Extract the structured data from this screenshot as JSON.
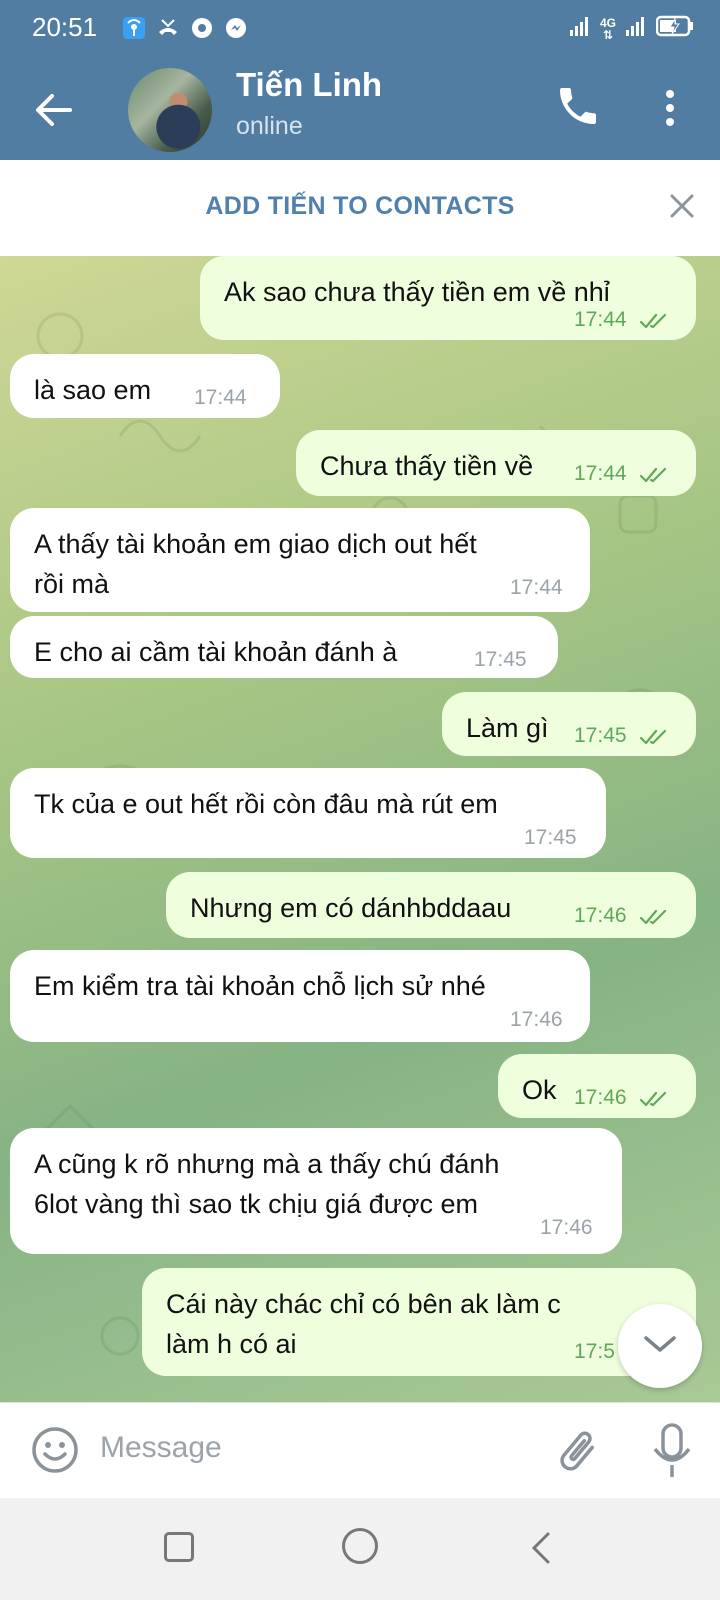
{
  "status_bar": {
    "time": "20:51",
    "network_label": "4G",
    "icons": [
      "hotspot-icon",
      "missed-call-icon",
      "chrome-icon",
      "messenger-icon",
      "signal-icon",
      "signal-icon",
      "battery-charging-icon"
    ]
  },
  "header": {
    "contact_name": "Tiến Linh",
    "presence": "online",
    "icons": [
      "back-arrow-icon",
      "phone-icon",
      "more-vertical-icon"
    ]
  },
  "contact_bar": {
    "add_label": "ADD TIẾN TO CONTACTS",
    "close_icon": "close-icon"
  },
  "messages": [
    {
      "side": "out",
      "text": "Ak sao chưa thấy tiền em về nhỉ",
      "time": "17:44",
      "read": true
    },
    {
      "side": "in",
      "text": "là sao em",
      "time": "17:44"
    },
    {
      "side": "out",
      "text": "Chưa thấy tiền về",
      "time": "17:44",
      "read": true
    },
    {
      "side": "in",
      "text": "A thấy tài khoản em giao dịch out hết\nrồi mà",
      "time": "17:44"
    },
    {
      "side": "in",
      "text": "E cho ai cầm tài khoản đánh à",
      "time": "17:45"
    },
    {
      "side": "out",
      "text": "Làm gì",
      "time": "17:45",
      "read": true
    },
    {
      "side": "in",
      "text": "Tk của e out hết rồi còn đâu mà rút em",
      "time": "17:45"
    },
    {
      "side": "out",
      "text": "Nhưng em có dánhbddaau",
      "time": "17:46",
      "read": true
    },
    {
      "side": "in",
      "text": "Em kiểm tra tài khoản chỗ lịch sử nhé",
      "time": "17:46"
    },
    {
      "side": "out",
      "text": "Ok",
      "time": "17:46",
      "read": true
    },
    {
      "side": "in",
      "text": "A  cũng k rõ nhưng mà a thấy chú đánh\n6lot vàng thì sao tk chịu giá được em",
      "time": "17:46"
    },
    {
      "side": "out",
      "text": "Cái này chác chỉ có bên ak làm c\nlàm h có ai",
      "time": "17:5"
    }
  ],
  "input": {
    "placeholder": "Message",
    "icons": [
      "emoji-icon",
      "attach-icon",
      "mic-icon"
    ]
  },
  "nav": {
    "icons": [
      "recents-icon",
      "home-icon",
      "back-icon"
    ]
  },
  "colors": {
    "header_bg": "#527da3",
    "accent": "#4f81ae",
    "outgoing_bubble": "#effedd",
    "incoming_bubble": "#ffffff",
    "read_tick": "#5fa85a"
  }
}
